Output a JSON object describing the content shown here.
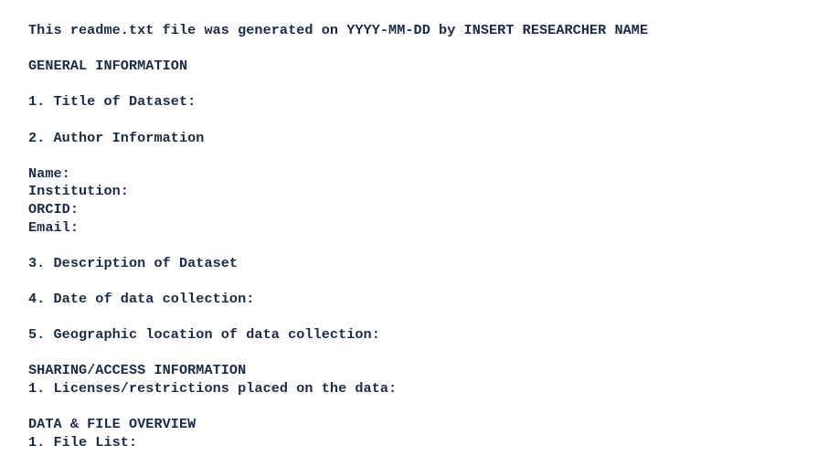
{
  "readme": {
    "generated_line": "This readme.txt file was generated on YYYY-MM-DD by INSERT RESEARCHER NAME",
    "general": {
      "heading": "GENERAL INFORMATION",
      "title": "1. Title of Dataset:",
      "author_heading": "2. Author Information",
      "name": "Name:",
      "institution": "Institution:",
      "orcid": "ORCID:",
      "email": "Email:",
      "description": "3. Description of Dataset",
      "date": "4. Date of data collection:",
      "location": "5. Geographic location of data collection:"
    },
    "sharing": {
      "heading": "SHARING/ACCESS INFORMATION",
      "licenses": "1. Licenses/restrictions placed on the data:"
    },
    "overview": {
      "heading": "DATA & FILE OVERVIEW",
      "file_list": "1. File List:"
    }
  }
}
